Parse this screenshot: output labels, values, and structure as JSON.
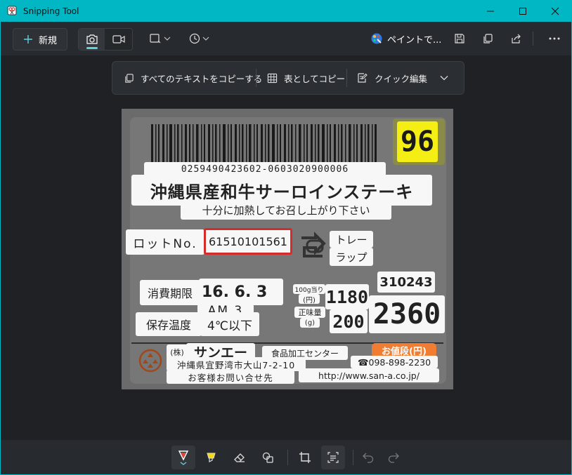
{
  "window": {
    "title": "Snipping Tool"
  },
  "toolbar": {
    "new_label": "新規",
    "paint_label": "ペイントで..."
  },
  "textbar": {
    "copy_all_label": "すべてのテキストをコピーする",
    "copy_table_label": "表としてコピー",
    "quick_edit_label": "クイック編集"
  },
  "label": {
    "number_badge": "96",
    "barcode_digits": "0259490423602-0603020900006",
    "product_name": "沖縄県産和牛サーロインステーキ",
    "cooking_note": "十分に加熱してお召し上がり下さい",
    "lot_label": "ロットNo.",
    "lot_value": "61510101561",
    "tray_line1": "トレー",
    "tray_line2": "ラップ",
    "expiry_label": "消費期限",
    "expiry_date": "16. 6. 3",
    "expiry_time": "AM 3",
    "storage_label": "保存温度",
    "storage_value": "4℃以下",
    "unit_price_label_1": "100g当り",
    "unit_price_label_2": "(円)",
    "weight_label_1": "正味量",
    "weight_label_2": "(g)",
    "unit_price": "1180",
    "weight": "200",
    "code": "310243",
    "price": "2360",
    "price_label": "お値段(円)",
    "company_prefix": "(株)",
    "company_name": "サンエー",
    "center_name": "食品加工センター",
    "phone": "☎098-898-2230",
    "address": "沖縄県宜野湾市大山7-2-10",
    "contact": "お客様お問い合せ先",
    "url": "http://www.san-a.co.jp/"
  },
  "colors": {
    "accent": "#00b7c3",
    "pen_red": "#e0443a",
    "highlighter_yellow": "#f5d90a",
    "badge_yellow": "#f4ee15",
    "lot_box_red": "#d62b2b",
    "price_orange": "#f07d32"
  }
}
